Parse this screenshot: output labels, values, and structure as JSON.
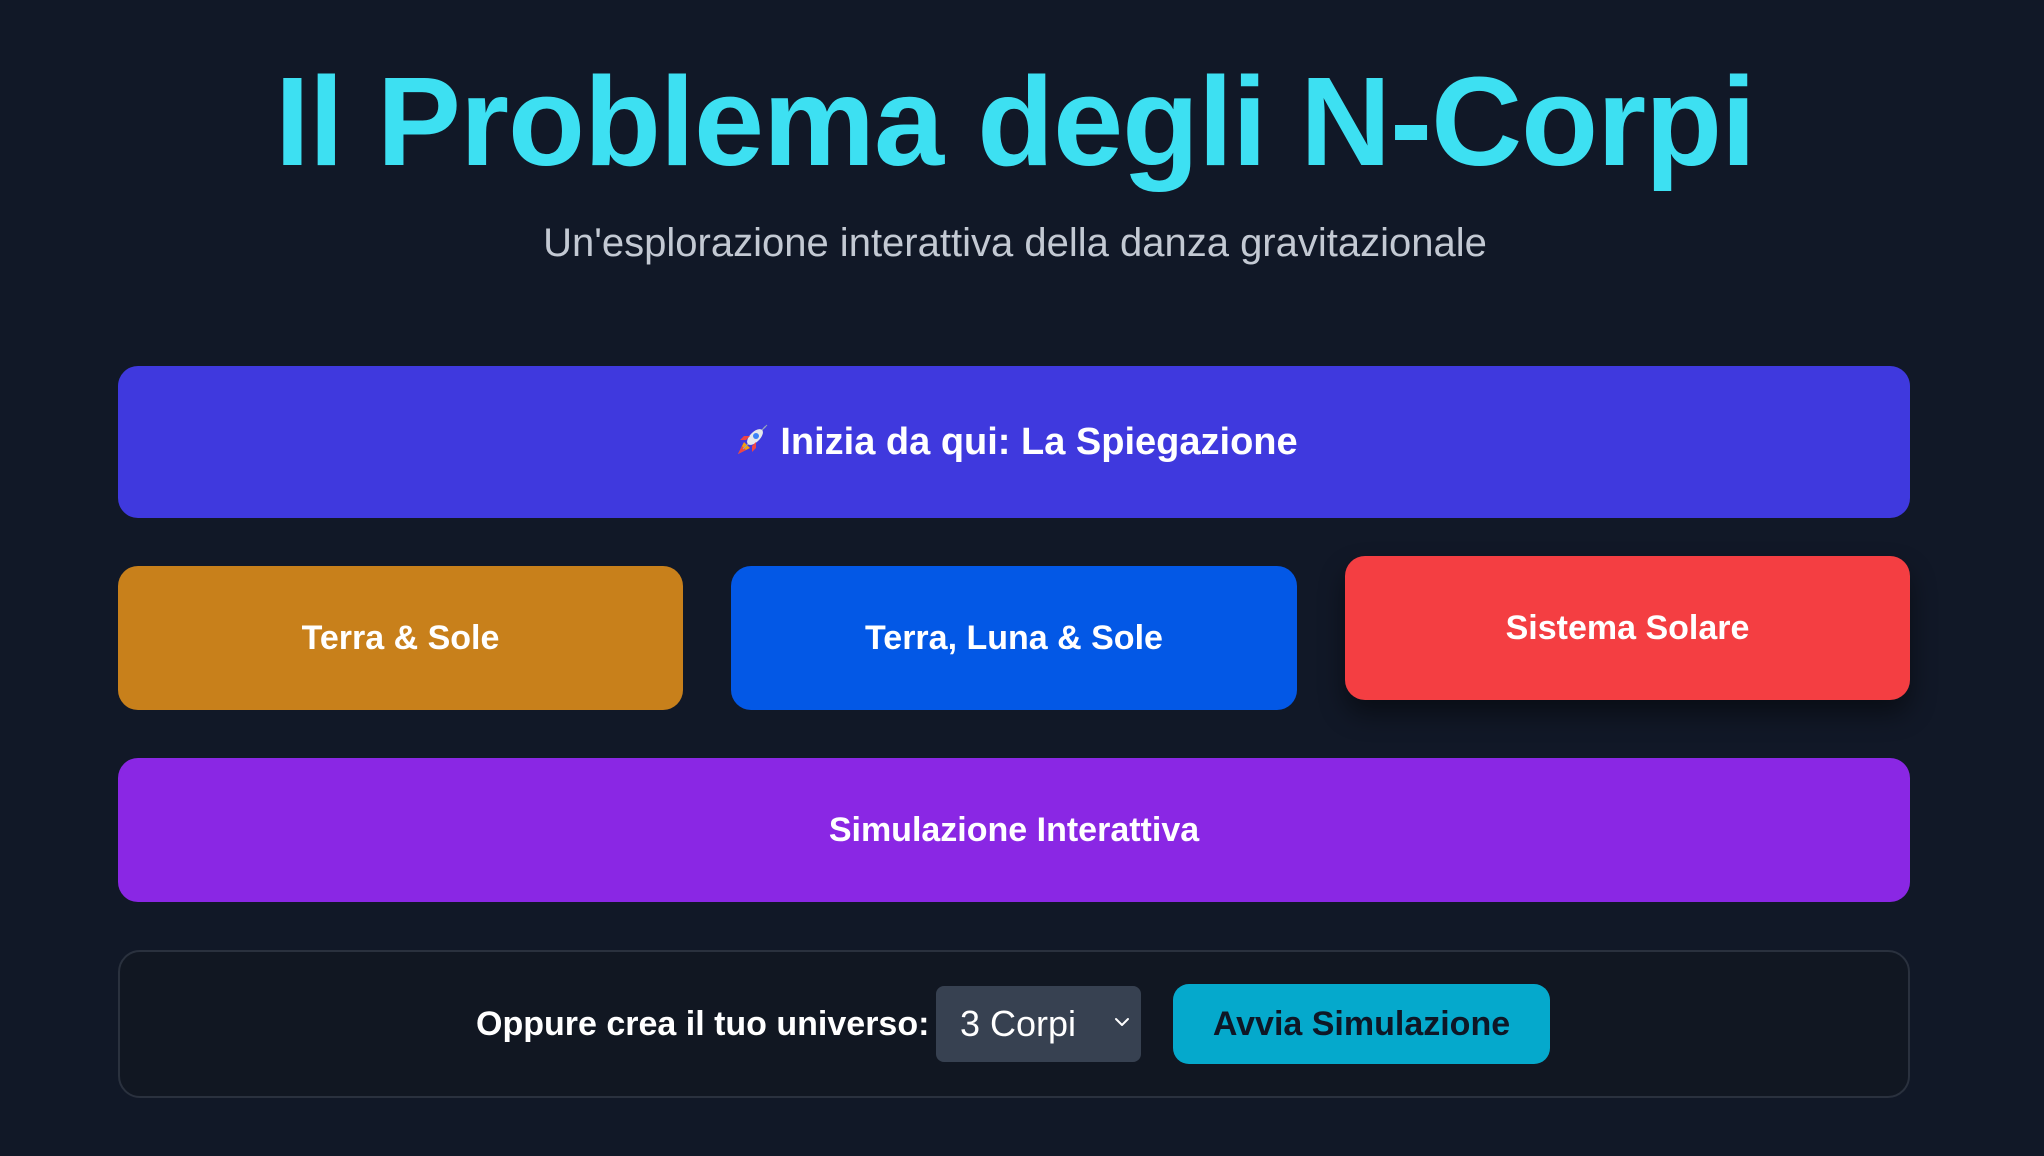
{
  "header": {
    "title": "Il Problema degli N-Corpi",
    "subtitle": "Un'esplorazione interattiva della danza gravitazionale"
  },
  "buttons": {
    "intro_label": "Inizia da qui: La Spiegazione",
    "intro_icon": "rocket-icon",
    "earth_sun_label": "Terra & Sole",
    "earth_moon_sun_label": "Terra, Luna & Sole",
    "solar_system_label": "Sistema Solare",
    "simulation_label": "Simulazione Interattiva"
  },
  "custom": {
    "label": "Oppure crea il tuo universo:",
    "select_value": "3 Corpi",
    "start_label": "Avvia Simulazione"
  },
  "colors": {
    "background": "#111827",
    "title": "#3de0f2",
    "intro": "#3f39de",
    "earth_sun": "#c8801b",
    "earth_moon_sun": "#0358e6",
    "solar_system": "#f43e42",
    "simulation": "#8a27e4",
    "start": "#05a9cc"
  }
}
